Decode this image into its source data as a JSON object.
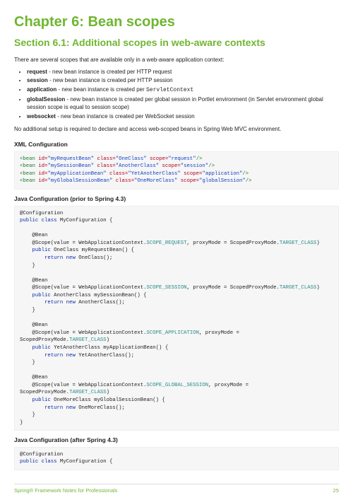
{
  "chapter": "Chapter 6: Bean scopes",
  "section": "Section 6.1: Additional scopes in web-aware contexts",
  "intro": "There are several scopes that are available only in a web-aware application context:",
  "scopes": [
    {
      "name": "request",
      "desc": " - new bean instance is created per HTTP request"
    },
    {
      "name": "session",
      "desc": " - new bean instance is created per HTTP session"
    },
    {
      "name": "application",
      "desc_pre": " - new bean instance is created per ",
      "code": "ServletContext"
    },
    {
      "name": "globalSession",
      "desc": " - new bean instance is created per global session in Portlet environment (in Servlet environment global session scope is equal to session scope)"
    },
    {
      "name": "websocket",
      "desc": " - new bean instance is created per WebSocket session"
    }
  ],
  "no_additional": "No additional setup is required to declare and access web-scoped beans in Spring Web MVC environment.",
  "xml_head": "XML Configuration",
  "xml_rows": [
    {
      "id": "myRequestBean",
      "cls": "OneClass",
      "scope": "request"
    },
    {
      "id": "mySessionBean",
      "cls": "AnotherClass",
      "scope": "session"
    },
    {
      "id": "myApplicationBean",
      "cls": "YetAnotherClass",
      "scope": "application"
    },
    {
      "id": "myGlobalSessionBean",
      "cls": "OneMoreClass",
      "scope": "globalSession"
    }
  ],
  "java43_head": "Java Configuration (prior to Spring 4.3)",
  "java43": {
    "ann": "@Configuration",
    "decl_pre": "public class",
    "decl_name": " MyConfiguration {",
    "beans": [
      {
        "scope_const": "SCOPE_REQUEST",
        "ret": "OneClass",
        "meth": "myRequestBean",
        "newc": "OneClass"
      },
      {
        "scope_const": "SCOPE_SESSION",
        "ret": "AnotherClass",
        "meth": "mySessionBean",
        "newc": "AnotherClass"
      },
      {
        "scope_const": "SCOPE_APPLICATION",
        "ret": "YetAnotherClass",
        "meth": "myApplicationBean",
        "newc": "YetAnotherClass"
      },
      {
        "scope_const": "SCOPE_GLOBAL_SESSION",
        "ret": "OneMoreClass",
        "meth": "myGlobalSessionBean",
        "newc": "OneMoreClass"
      }
    ],
    "scope_prefix": "    @Scope(value = WebApplicationContext.",
    "scope_tail_inline": ", proxyMode = ScopedProxyMode.",
    "scope_tail_wrap_a": ", proxyMode =",
    "scope_tail_wrap_b": "ScopedProxyMode.",
    "target_class": "TARGET_CLASS",
    "close_paren": ")",
    "bean_ann": "    @Bean",
    "public": "public",
    "return_kw": "return new",
    "close_brace": "}"
  },
  "java_after_head": "Java Configuration (after Spring 4.3)",
  "java_after": {
    "ann": "@Configuration",
    "decl_pre": "public class",
    "decl_name": " MyConfiguration {"
  },
  "footer_left": "Spring® Framework Notes for Professionals",
  "footer_right": "25"
}
